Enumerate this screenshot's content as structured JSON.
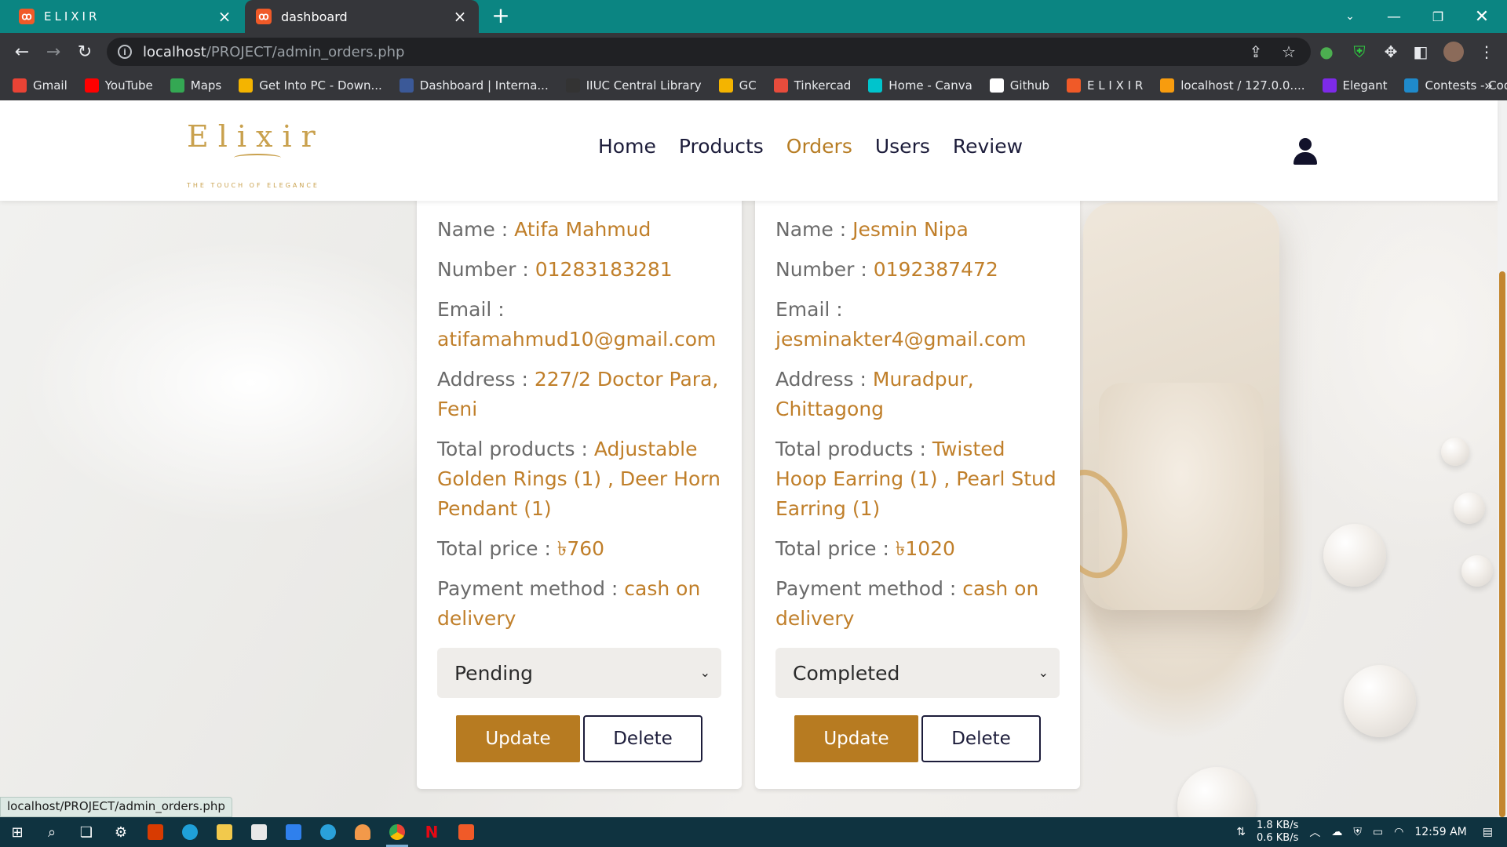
{
  "browser": {
    "tabs": [
      {
        "title": "ELIXIR",
        "active": false
      },
      {
        "title": "dashboard",
        "active": true
      }
    ],
    "url_host": "localhost",
    "url_path": "/PROJECT/admin_orders.php",
    "bookmarks": [
      {
        "label": "Gmail",
        "icon": "gmail-icon",
        "color": "#ea4335"
      },
      {
        "label": "YouTube",
        "icon": "youtube-icon",
        "color": "#ff0000"
      },
      {
        "label": "Maps",
        "icon": "maps-icon",
        "color": "#34a853"
      },
      {
        "label": "Get Into PC - Down...",
        "icon": "getintopc-icon",
        "color": "#f4b400"
      },
      {
        "label": "Dashboard | Interna...",
        "icon": "dashboard-icon",
        "color": "#3b5998"
      },
      {
        "label": "IIUC Central Library",
        "icon": "library-icon",
        "color": "#333333"
      },
      {
        "label": "GC",
        "icon": "classroom-icon",
        "color": "#f4b400"
      },
      {
        "label": "Tinkercad",
        "icon": "tinkercad-icon",
        "color": "#e74c3c"
      },
      {
        "label": "Home - Canva",
        "icon": "canva-icon",
        "color": "#00c4cc"
      },
      {
        "label": "Github",
        "icon": "github-icon",
        "color": "#ffffff"
      },
      {
        "label": "E L I X I R",
        "icon": "elixir-icon",
        "color": "#f05a28"
      },
      {
        "label": "localhost / 127.0.0....",
        "icon": "phpmyadmin-icon",
        "color": "#f89c0e"
      },
      {
        "label": "Elegant",
        "icon": "canva-icon",
        "color": "#7d2ae8"
      },
      {
        "label": "Contests - Codefor...",
        "icon": "codeforces-icon",
        "color": "#1f8acb"
      }
    ],
    "status_url": "localhost/PROJECT/admin_orders.php"
  },
  "site": {
    "logo_text": "Elixir",
    "logo_tagline": "THE TOUCH OF ELEGANCE",
    "nav": [
      {
        "label": "Home",
        "active": false
      },
      {
        "label": "Products",
        "active": false
      },
      {
        "label": "Orders",
        "active": true
      },
      {
        "label": "Users",
        "active": false
      },
      {
        "label": "Review",
        "active": false
      }
    ],
    "accent_color": "#b77b21"
  },
  "orders": [
    {
      "name_label": "Name :",
      "name": "Atifa Mahmud",
      "number_label": "Number :",
      "number": "01283183281",
      "email_label": "Email :",
      "email": "atifamahmud10@gmail.com",
      "address_label": "Address :",
      "address": "227/2 Doctor Para, Feni",
      "products_label": "Total products :",
      "products": "Adjustable Golden Rings (1) , Deer Horn Pendant (1)",
      "price_label": "Total price :",
      "price": "৳760",
      "payment_label": "Payment method :",
      "payment": "cash on delivery",
      "status": "Pending",
      "update_label": "Update",
      "delete_label": "Delete"
    },
    {
      "name_label": "Name :",
      "name": "Jesmin Nipa",
      "number_label": "Number :",
      "number": "0192387472",
      "email_label": "Email :",
      "email": "jesminakter4@gmail.com",
      "address_label": "Address :",
      "address": "Muradpur, Chittagong",
      "products_label": "Total products :",
      "products": "Twisted Hoop Earring (1) , Pearl Stud Earring (1)",
      "price_label": "Total price :",
      "price": "৳1020",
      "payment_label": "Payment method :",
      "payment": "cash on delivery",
      "status": "Completed",
      "update_label": "Update",
      "delete_label": "Delete"
    }
  ],
  "taskbar": {
    "net_up": "1.8 KB/s",
    "net_down": "0.6 KB/s",
    "time": "12:59 AM"
  }
}
